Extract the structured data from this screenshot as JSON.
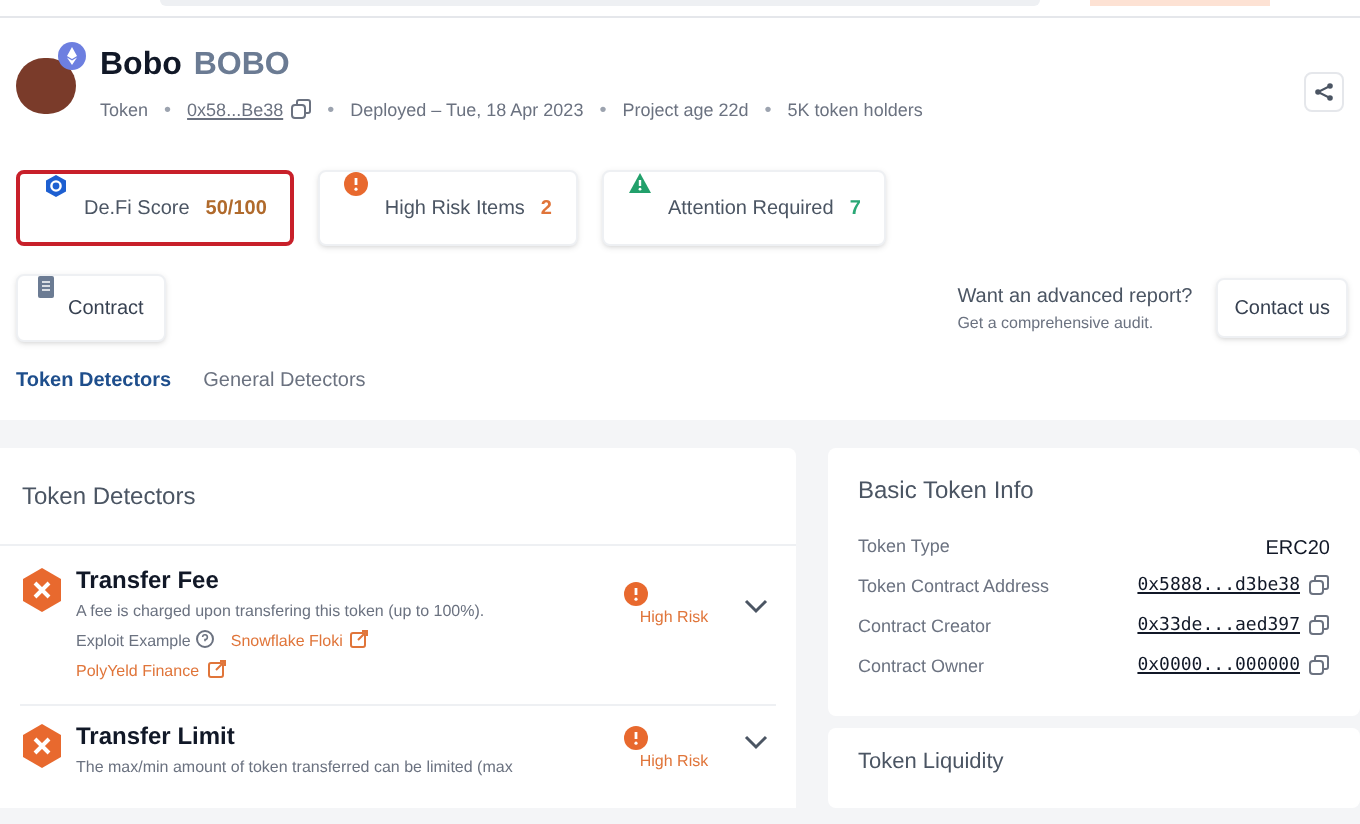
{
  "token": {
    "name": "Bobo",
    "symbol": "BOBO",
    "type": "Token",
    "address": "0x58...Be38",
    "deployed": "Deployed – Tue, 18 Apr 2023",
    "age": "Project age 22d",
    "holders": "5K token holders",
    "separators": [
      "•",
      "•",
      "•",
      "•"
    ]
  },
  "stats": [
    {
      "kind": "score",
      "label": "De.Fi Score",
      "value": "50/100",
      "highlighted": true
    },
    {
      "kind": "risk",
      "label": "High Risk Items",
      "value": "2",
      "highlighted": false
    },
    {
      "kind": "attention",
      "label": "Attention Required",
      "value": "7",
      "highlighted": false
    }
  ],
  "contract_button": "Contract",
  "report": {
    "title": "Want an advanced report?",
    "subtitle": "Get a comprehensive audit.",
    "button": "Contact us"
  },
  "tabs": [
    {
      "label": "Token Detectors",
      "selected": true
    },
    {
      "label": "General Detectors",
      "selected": false
    }
  ],
  "detectors": {
    "title": "Token Detectors",
    "items": [
      {
        "title": "Transfer Fee",
        "description": "A fee is charged upon transfering this token (up to 100%).",
        "exploit_label": "Exploit Example",
        "exploits": [
          "Snowflake Floki",
          "PolyYeld Finance"
        ],
        "risk": "High Risk"
      },
      {
        "title": "Transfer Limit",
        "description": "The max/min amount of token transferred can be limited (max",
        "risk": "High Risk"
      }
    ]
  },
  "basic_info": {
    "title": "Basic Token Info",
    "rows": [
      {
        "label": "Token Type",
        "value": "ERC20",
        "kind": "text"
      },
      {
        "label": "Token Contract Address",
        "value": "0x5888...d3be38",
        "kind": "address"
      },
      {
        "label": "Contract Creator",
        "value": "0x33de...aed397",
        "kind": "address"
      },
      {
        "label": "Contract Owner",
        "value": "0x0000...000000",
        "kind": "address"
      }
    ]
  },
  "liquidity": {
    "title": "Token Liquidity"
  }
}
